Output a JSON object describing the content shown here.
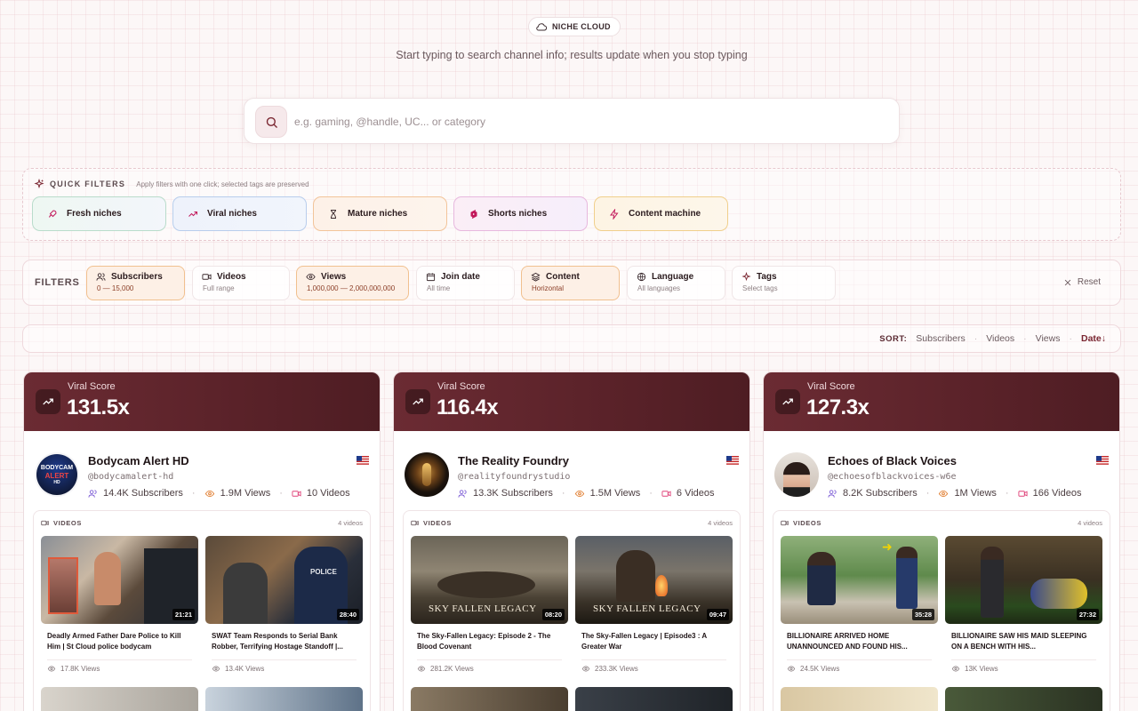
{
  "brand": {
    "name": "NICHE CLOUD",
    "icon": "cloud-icon"
  },
  "subtitle": "Start typing to search channel info; results update when you stop typing",
  "search": {
    "placeholder": "e.g. gaming, @handle, UC... or category",
    "value": "",
    "icon": "search-icon"
  },
  "quick_filters": {
    "title": "QUICK FILTERS",
    "subtitle": "Apply filters with one click; selected tags are preserved",
    "items": [
      {
        "label": "Fresh niches",
        "icon": "rocket-icon",
        "color": "#2f8f6a"
      },
      {
        "label": "Viral niches",
        "icon": "trending-up-icon",
        "color": "#3b6fc9"
      },
      {
        "label": "Mature niches",
        "icon": "hourglass-icon",
        "color": "#c65a2a"
      },
      {
        "label": "Shorts niches",
        "icon": "shorts-icon",
        "color": "#c2185b"
      },
      {
        "label": "Content machine",
        "icon": "zap-icon",
        "color": "#c7891a"
      }
    ]
  },
  "filters": {
    "label": "FILTERS",
    "reset_label": "Reset",
    "items": [
      {
        "label": "Subscribers",
        "value": "0 — 15,000",
        "icon": "users-icon",
        "active": true
      },
      {
        "label": "Videos",
        "value": "Full range",
        "icon": "video-icon",
        "active": false
      },
      {
        "label": "Views",
        "value": "1,000,000 — 2,000,000,000",
        "icon": "eye-icon",
        "active": true
      },
      {
        "label": "Join date",
        "value": "All time",
        "icon": "calendar-icon",
        "active": false
      },
      {
        "label": "Content",
        "value": "Horizontal",
        "icon": "layers-icon",
        "active": true
      },
      {
        "label": "Language",
        "value": "All languages",
        "icon": "globe-icon",
        "active": false
      },
      {
        "label": "Tags",
        "value": "Select tags",
        "icon": "sparkle-icon",
        "active": false
      }
    ]
  },
  "sort": {
    "label": "SORT:",
    "options": [
      "Subscribers",
      "Videos",
      "Views",
      "Date"
    ],
    "active": "Date",
    "active_indicator": "↓"
  },
  "cards": [
    {
      "viral_label": "Viral Score",
      "viral_score": "131.5x",
      "name": "Bodycam Alert HD",
      "handle": "@bodycamalert-hd",
      "subscribers": "14.4K Subscribers",
      "views": "1.9M Views",
      "videos": "10 Videos",
      "avatar_text": "BODYCAM",
      "avatar_text2": "ALERT",
      "avatar_text3": "HD",
      "videos_label": "VIDEOS",
      "videos_count": "4 videos",
      "items": [
        {
          "title": "Deadly Armed Father Dare Police to Kill Him | St Cloud police bodycam",
          "views": "17.8K Views",
          "duration": "21:21"
        },
        {
          "title": "SWAT Team Responds to Serial Bank Robber, Terrifying Hostage Standoff |...",
          "views": "13.4K Views",
          "duration": "28:40"
        }
      ]
    },
    {
      "viral_label": "Viral Score",
      "viral_score": "116.4x",
      "name": "The Reality Foundry",
      "handle": "@realityfoundrystudio",
      "subscribers": "13.3K Subscribers",
      "views": "1.5M Views",
      "videos": "6 Videos",
      "videos_label": "VIDEOS",
      "videos_count": "4 videos",
      "items": [
        {
          "title": "The Sky-Fallen Legacy: Episode 2 - The Blood Covenant",
          "views": "281.2K Views",
          "duration": "08:20",
          "overlay": "SKY FALLEN LEGACY"
        },
        {
          "title": "The Sky-Fallen Legacy | Episode3 : A Greater War",
          "views": "233.3K Views",
          "duration": "09:47",
          "overlay": "SKY FALLEN LEGACY"
        }
      ]
    },
    {
      "viral_label": "Viral Score",
      "viral_score": "127.3x",
      "name": "Echoes of Black Voices",
      "handle": "@echoesofblackvoices-w6e",
      "subscribers": "8.2K Subscribers",
      "views": "1M Views",
      "videos": "166 Videos",
      "videos_label": "VIDEOS",
      "videos_count": "4 videos",
      "items": [
        {
          "title": "BILLIONAIRE ARRIVED HOME UNANNOUNCED AND FOUND HIS...",
          "views": "24.5K Views",
          "duration": "35:28"
        },
        {
          "title": "BILLIONAIRE SAW HIS MAID SLEEPING ON A BENCH WITH HIS...",
          "views": "13K Views",
          "duration": "27:32"
        }
      ]
    }
  ]
}
